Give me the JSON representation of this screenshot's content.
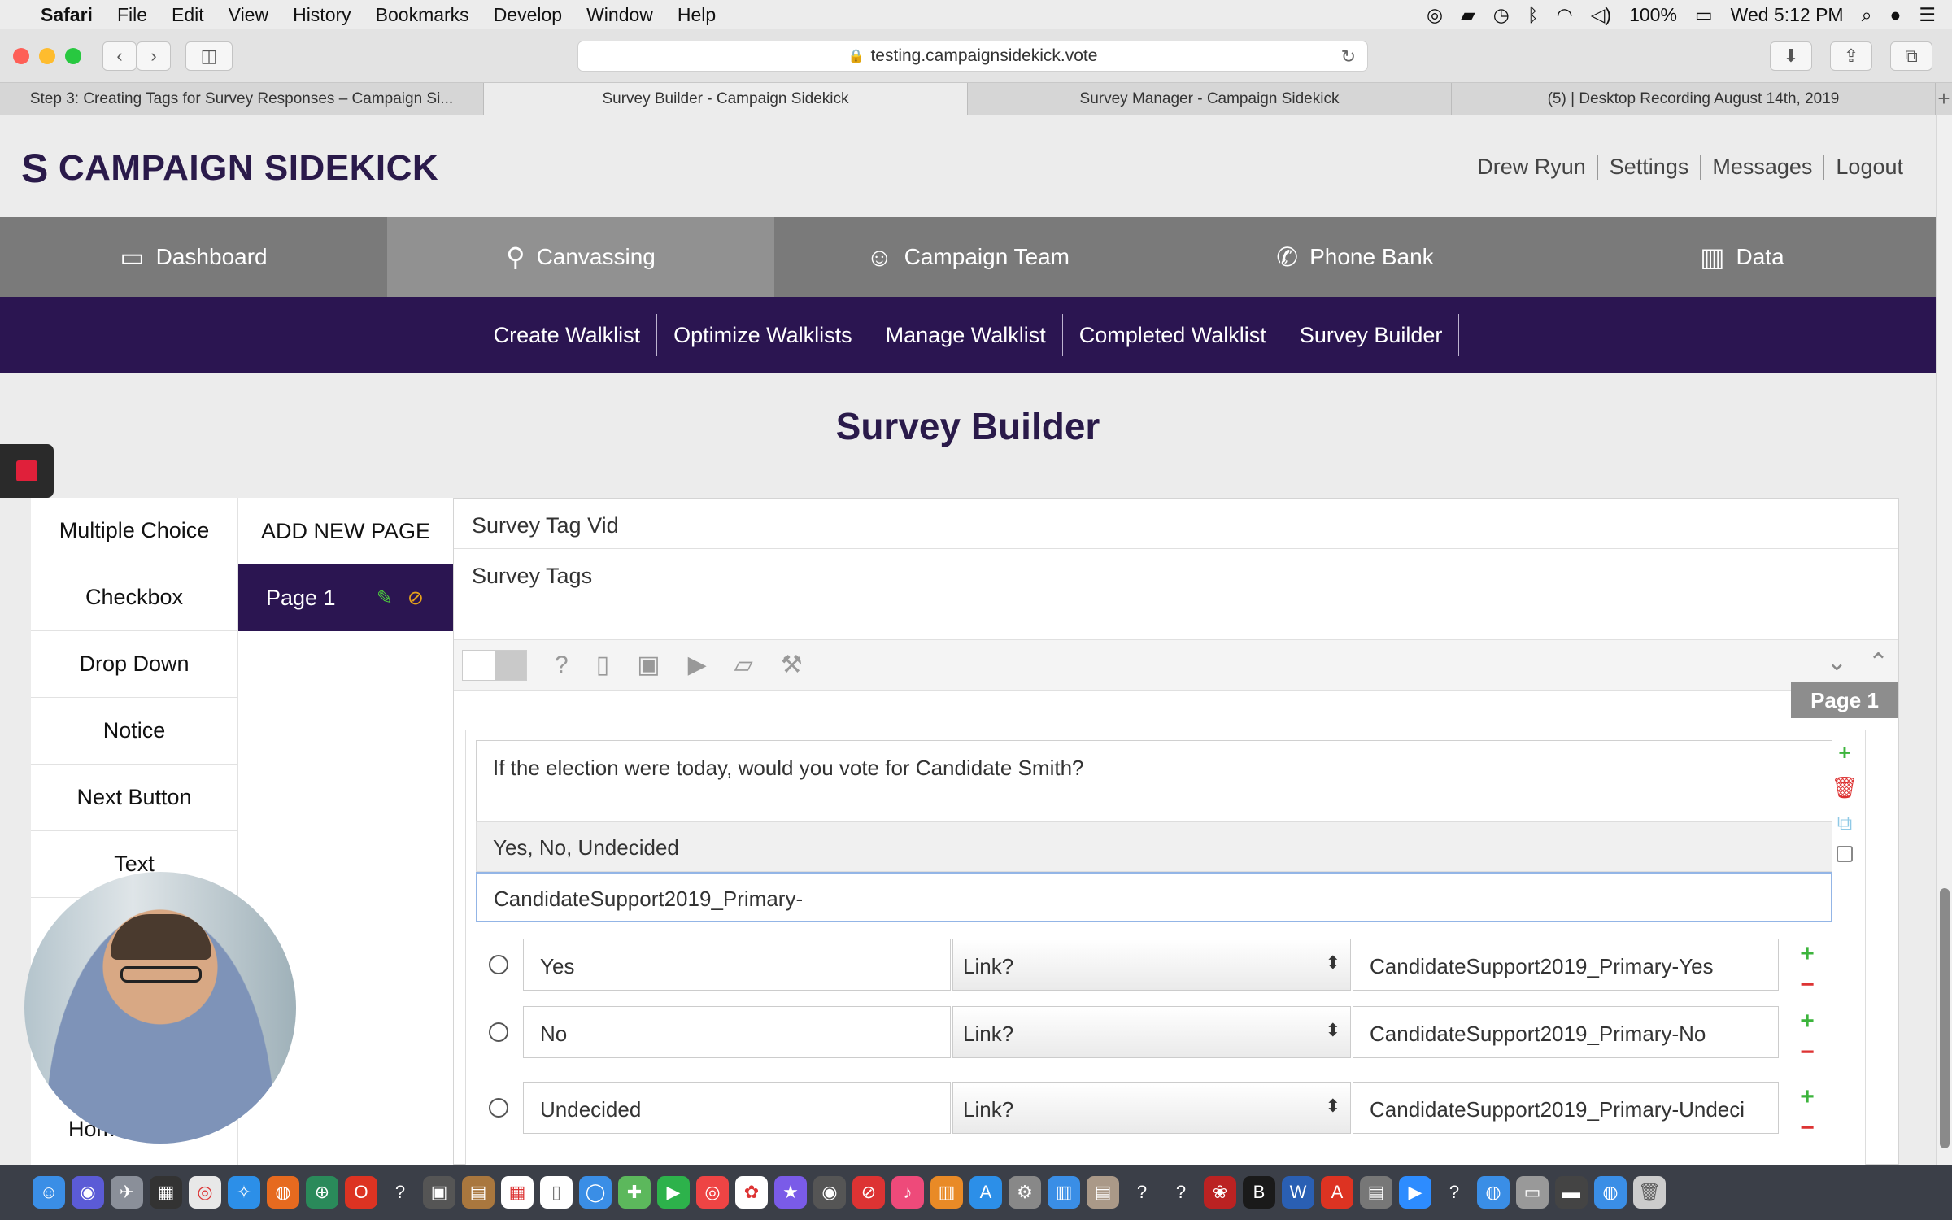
{
  "menubar": {
    "app": "Safari",
    "items": [
      "File",
      "Edit",
      "View",
      "History",
      "Bookmarks",
      "Develop",
      "Window",
      "Help"
    ],
    "battery": "100%",
    "clock": "Wed 5:12 PM"
  },
  "browser": {
    "url": "testing.campaignsidekick.vote",
    "tabs": [
      "Step 3: Creating Tags for Survey Responses – Campaign Si...",
      "Survey Builder - Campaign Sidekick",
      "Survey Manager - Campaign Sidekick",
      "(5) | Desktop Recording August 14th, 2019"
    ]
  },
  "site": {
    "logo": "CAMPAIGN SIDEKICK",
    "user_nav": [
      "Drew Ryun",
      "Settings",
      "Messages",
      "Logout"
    ],
    "main_nav": [
      {
        "label": "Dashboard",
        "icon": "dashboard-icon"
      },
      {
        "label": "Canvassing",
        "icon": "map-pin-icon"
      },
      {
        "label": "Campaign Team",
        "icon": "team-icon"
      },
      {
        "label": "Phone Bank",
        "icon": "phone-icon"
      },
      {
        "label": "Data",
        "icon": "bar-chart-icon"
      }
    ],
    "sub_nav": [
      "Create Walklist",
      "Optimize Walklists",
      "Manage Walklist",
      "Completed Walklist",
      "Survey Builder"
    ],
    "page_title": "Survey Builder"
  },
  "palette": [
    "Multiple Choice",
    "Checkbox",
    "Drop Down",
    "Notice",
    "Next Button",
    "Text"
  ],
  "pages": {
    "add_label": "ADD NEW PAGE",
    "items": [
      "Page 1"
    ]
  },
  "builder": {
    "survey_name": "Survey Tag Vid",
    "survey_tags": "Survey Tags",
    "page_label": "Page 1",
    "question": "If the election were today, would you vote for Candidate Smith?",
    "choices": "Yes, No, Undecided",
    "tag_prefix": "CandidateSupport2019_Primary-",
    "options": [
      {
        "label": "Yes",
        "link": "Link?",
        "tag": "CandidateSupport2019_Primary-Yes"
      },
      {
        "label": "No",
        "link": "Link?",
        "tag": "CandidateSupport2019_Primary-No"
      },
      {
        "label": "Undecided",
        "link": "Link?",
        "tag": "CandidateSupport2019_Primary-Undeci"
      }
    ]
  },
  "partial_text": "Hom"
}
